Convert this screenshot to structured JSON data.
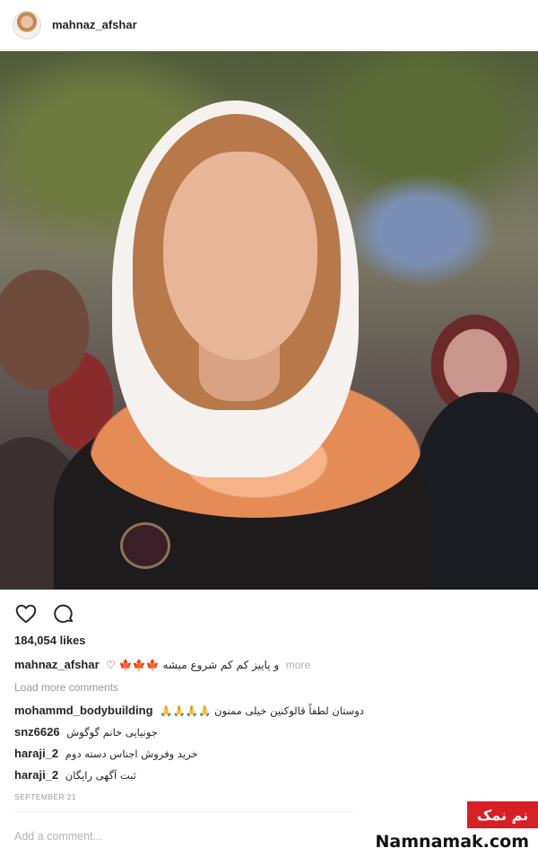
{
  "post": {
    "username": "mahnaz_afshar",
    "likes": "184,054 likes",
    "caption": {
      "username": "mahnaz_afshar",
      "text": "و پاییز کم کم شروع میشه 🍁🍁🍁 ♡",
      "more": "more"
    },
    "load_more": "Load more comments",
    "comments": [
      {
        "user": "mohammd_bodybuilding",
        "text": "دوستان لطفاً قالوکنین خیلی ممنون 🙏🙏🙏🙏"
      },
      {
        "user": "snz6626",
        "text": "جونیایی خانم گوگوش"
      },
      {
        "user": "haraji_2",
        "text": "خرید وفروش اجناس دسته دوم"
      },
      {
        "user": "haraji_2",
        "text": "ثبت آگهی رایگان"
      }
    ],
    "timestamp": "SEPTEMBER 21",
    "add_comment_placeholder": "Add a comment..."
  },
  "icons": {
    "like": "heart-icon",
    "comment": "comment-icon"
  },
  "watermark": {
    "badge": "نم نمک",
    "site": "Namnamak.com",
    "badge_color": "#d81f26"
  }
}
